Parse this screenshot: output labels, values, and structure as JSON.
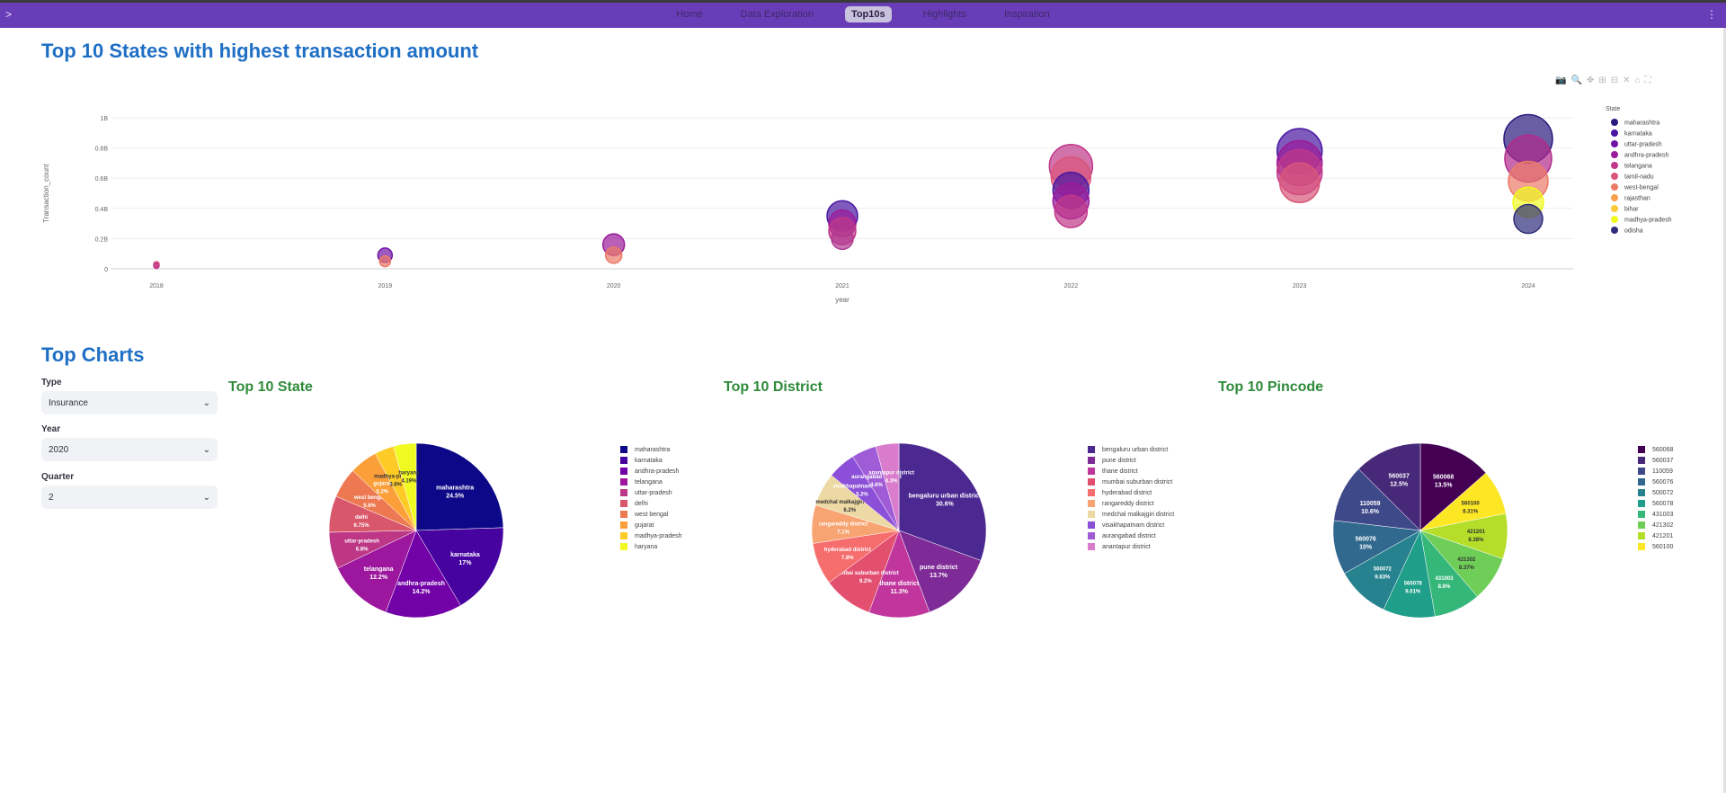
{
  "nav": {
    "toggle": ">",
    "menu": "⋮",
    "items": [
      {
        "label": "Home"
      },
      {
        "label": "Data Exploration"
      },
      {
        "label": "Top10s"
      },
      {
        "label": "Highlights"
      },
      {
        "label": "Inspiration"
      }
    ],
    "active_index": 2
  },
  "section1_title": "Top 10 States with highest transaction amount",
  "modebar_icons": [
    "camera-icon",
    "zoom-icon",
    "pan-icon",
    "zoom-in-icon",
    "zoom-out-icon",
    "autoscale-icon",
    "home-icon",
    "fullscreen-icon"
  ],
  "bubble_chart": {
    "type": "scatter",
    "xlabel": "year",
    "ylabel": "Transaction_count",
    "legend_title": "State",
    "x_ticks": [
      "2018",
      "2019",
      "2020",
      "2021",
      "2022",
      "2023",
      "2024"
    ],
    "y_ticks": [
      {
        "v": 0,
        "label": "0"
      },
      {
        "v": 0.2,
        "label": "0.2B"
      },
      {
        "v": 0.4,
        "label": "0.4B"
      },
      {
        "v": 0.6,
        "label": "0.6B"
      },
      {
        "v": 0.8,
        "label": "0.8B"
      },
      {
        "v": 1.0,
        "label": "1B"
      }
    ],
    "ylim": [
      0,
      1.0
    ],
    "legend": [
      {
        "name": "maharashtra",
        "color": "#2a1a7d"
      },
      {
        "name": "karnataka",
        "color": "#4a16a3"
      },
      {
        "name": "uttar-pradesh",
        "color": "#7113a6"
      },
      {
        "name": "andhra-pradesh",
        "color": "#9a1b9a"
      },
      {
        "name": "telangana",
        "color": "#c13789"
      },
      {
        "name": "tamil-nadu",
        "color": "#d9577a"
      },
      {
        "name": "west-bengal",
        "color": "#eb7a66"
      },
      {
        "name": "rajasthan",
        "color": "#f7a14d"
      },
      {
        "name": "bihar",
        "color": "#fccb3a"
      },
      {
        "name": "madhya-pradesh",
        "color": "#f0f921"
      },
      {
        "name": "odisha",
        "color": "#2f2d7a"
      }
    ],
    "points": [
      {
        "year": 2018,
        "y": 0.03,
        "r": 3,
        "color": "#d9577a"
      },
      {
        "year": 2018,
        "y": 0.02,
        "r": 3,
        "color": "#c13789"
      },
      {
        "year": 2019,
        "y": 0.09,
        "r": 8,
        "color": "#7113a6"
      },
      {
        "year": 2019,
        "y": 0.05,
        "r": 6,
        "color": "#eb7a66"
      },
      {
        "year": 2020,
        "y": 0.16,
        "r": 12,
        "color": "#9a1b9a"
      },
      {
        "year": 2020,
        "y": 0.09,
        "r": 9,
        "color": "#eb7a66"
      },
      {
        "year": 2021,
        "y": 0.35,
        "r": 17,
        "color": "#4a16a3"
      },
      {
        "year": 2021,
        "y": 0.3,
        "r": 15,
        "color": "#9a1b9a"
      },
      {
        "year": 2021,
        "y": 0.25,
        "r": 15,
        "color": "#c13789"
      },
      {
        "year": 2021,
        "y": 0.2,
        "r": 12,
        "color": "#b03a90"
      },
      {
        "year": 2022,
        "y": 0.68,
        "r": 24,
        "color": "#c13789"
      },
      {
        "year": 2022,
        "y": 0.61,
        "r": 22,
        "color": "#d9577a"
      },
      {
        "year": 2022,
        "y": 0.52,
        "r": 20,
        "color": "#4a16a3"
      },
      {
        "year": 2022,
        "y": 0.45,
        "r": 20,
        "color": "#9a1b9a"
      },
      {
        "year": 2022,
        "y": 0.38,
        "r": 18,
        "color": "#c13789"
      },
      {
        "year": 2023,
        "y": 0.78,
        "r": 25,
        "color": "#4a16a3"
      },
      {
        "year": 2023,
        "y": 0.7,
        "r": 25,
        "color": "#9a1b9a"
      },
      {
        "year": 2023,
        "y": 0.64,
        "r": 25,
        "color": "#c13789"
      },
      {
        "year": 2023,
        "y": 0.57,
        "r": 22,
        "color": "#d9577a"
      },
      {
        "year": 2024,
        "y": 0.86,
        "r": 27,
        "color": "#2a1a7d"
      },
      {
        "year": 2024,
        "y": 0.73,
        "r": 26,
        "color": "#b02a8a"
      },
      {
        "year": 2024,
        "y": 0.58,
        "r": 22,
        "color": "#eb7a66"
      },
      {
        "year": 2024,
        "y": 0.44,
        "r": 17,
        "color": "#f0f921"
      },
      {
        "year": 2024,
        "y": 0.33,
        "r": 16,
        "color": "#2f2d7a"
      }
    ]
  },
  "section2_title": "Top Charts",
  "controls": [
    {
      "label": "Type",
      "value": "Insurance"
    },
    {
      "label": "Year",
      "value": "2020"
    },
    {
      "label": "Quarter",
      "value": "2"
    }
  ],
  "pies": [
    {
      "title": "Top 10 State",
      "type": "pie",
      "slices": [
        {
          "label": "maharashtra",
          "pct": 24.5,
          "color": "#0d0887"
        },
        {
          "label": "karnataka",
          "pct": 17,
          "color": "#46039f"
        },
        {
          "label": "andhra-pradesh",
          "pct": 14.2,
          "color": "#7201a8"
        },
        {
          "label": "telangana",
          "pct": 12.2,
          "color": "#9c179e"
        },
        {
          "label": "uttar-pradesh",
          "pct": 6.8,
          "color": "#bd3786"
        },
        {
          "label": "delhi",
          "pct": 6.75,
          "color": "#d8576b"
        },
        {
          "label": "west bengal",
          "pct": 5.6,
          "color": "#ed7953"
        },
        {
          "label": "gujarat",
          "pct": 5.2,
          "color": "#fb9f3a"
        },
        {
          "label": "madhya-pradesh",
          "pct": 3.6,
          "color": "#fdca26"
        },
        {
          "label": "haryana",
          "pct": 4.19,
          "color": "#f0f921"
        }
      ]
    },
    {
      "title": "Top 10 District",
      "type": "pie",
      "slices": [
        {
          "label": "bengaluru urban district",
          "pct": 30.6,
          "color": "#4b2991"
        },
        {
          "label": "pune district",
          "pct": 13.7,
          "color": "#7e2b97"
        },
        {
          "label": "thane district",
          "pct": 11.3,
          "color": "#c0369d"
        },
        {
          "label": "mumbai suburban district",
          "pct": 9.2,
          "color": "#e34f6f"
        },
        {
          "label": "hyderabad district",
          "pct": 7.8,
          "color": "#f66d6d"
        },
        {
          "label": "rangareddy district",
          "pct": 7.1,
          "color": "#f7a472"
        },
        {
          "label": "medchal malkajgiri district",
          "pct": 6.2,
          "color": "#edd9a3"
        },
        {
          "label": "visakhapatnam district",
          "pct": 5.2,
          "color": "#8b4fd8"
        },
        {
          "label": "aurangabad district",
          "pct": 4.6,
          "color": "#a05cd6"
        },
        {
          "label": "anantapur district",
          "pct": 4.3,
          "color": "#d97ccc"
        }
      ]
    },
    {
      "title": "Top 10 Pincode",
      "type": "pie",
      "slices": [
        {
          "label": "560068",
          "pct": 13.5,
          "color": "#440154"
        },
        {
          "label": "560100",
          "pct": 8.31,
          "color": "#fde725"
        },
        {
          "label": "421201",
          "pct": 8.38,
          "color": "#b5de2b"
        },
        {
          "label": "421302",
          "pct": 8.37,
          "color": "#6ece58"
        },
        {
          "label": "431003",
          "pct": 8.6,
          "color": "#35b779"
        },
        {
          "label": "560078",
          "pct": 9.61,
          "color": "#1f9e89"
        },
        {
          "label": "500072",
          "pct": 9.83,
          "color": "#26828e"
        },
        {
          "label": "560076",
          "pct": 10,
          "color": "#31688e"
        },
        {
          "label": "110059",
          "pct": 10.6,
          "color": "#3e4989"
        },
        {
          "label": "560037",
          "pct": 12.5,
          "color": "#482878"
        }
      ],
      "legend_order": [
        "560068",
        "560037",
        "110059",
        "560076",
        "500072",
        "560078",
        "431003",
        "421302",
        "421201",
        "560100"
      ]
    }
  ]
}
